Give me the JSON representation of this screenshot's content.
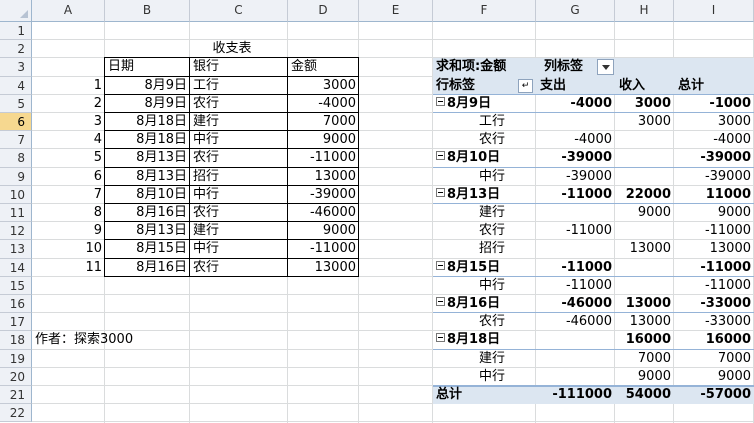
{
  "columns": [
    "A",
    "B",
    "C",
    "D",
    "E",
    "F",
    "G",
    "H",
    "I"
  ],
  "rows": [
    "1",
    "2",
    "3",
    "4",
    "5",
    "6",
    "7",
    "8",
    "9",
    "10",
    "11",
    "12",
    "13",
    "14",
    "15",
    "16",
    "17",
    "18",
    "19",
    "20",
    "21",
    "22"
  ],
  "selected_row": "6",
  "table": {
    "title": "收支表",
    "headers": [
      "日期",
      "银行",
      "金额"
    ],
    "rows": [
      {
        "idx": "1",
        "date": "8月9日",
        "bank": "工行",
        "amount": "3000"
      },
      {
        "idx": "2",
        "date": "8月9日",
        "bank": "农行",
        "amount": "-4000"
      },
      {
        "idx": "3",
        "date": "8月18日",
        "bank": "建行",
        "amount": "7000"
      },
      {
        "idx": "4",
        "date": "8月18日",
        "bank": "中行",
        "amount": "9000"
      },
      {
        "idx": "5",
        "date": "8月13日",
        "bank": "农行",
        "amount": "-11000"
      },
      {
        "idx": "6",
        "date": "8月13日",
        "bank": "招行",
        "amount": "13000"
      },
      {
        "idx": "7",
        "date": "8月10日",
        "bank": "中行",
        "amount": "-39000"
      },
      {
        "idx": "8",
        "date": "8月16日",
        "bank": "农行",
        "amount": "-46000"
      },
      {
        "idx": "9",
        "date": "8月13日",
        "bank": "建行",
        "amount": "9000"
      },
      {
        "idx": "10",
        "date": "8月15日",
        "bank": "中行",
        "amount": "-11000"
      },
      {
        "idx": "11",
        "date": "8月16日",
        "bank": "农行",
        "amount": "13000"
      }
    ]
  },
  "author": "作者：探索3000",
  "pivot": {
    "value_field": "求和项:金额",
    "col_label": "列标签",
    "row_label": "行标签",
    "col_headers": [
      "支出",
      "收入",
      "总计"
    ],
    "rows": [
      {
        "type": "group",
        "label": "8月9日",
        "v": [
          "-4000",
          "3000",
          "-1000"
        ]
      },
      {
        "type": "item",
        "label": "工行",
        "v": [
          "",
          "3000",
          "3000"
        ]
      },
      {
        "type": "item",
        "label": "农行",
        "v": [
          "-4000",
          "",
          "-4000"
        ]
      },
      {
        "type": "group",
        "label": "8月10日",
        "v": [
          "-39000",
          "",
          "-39000"
        ]
      },
      {
        "type": "item",
        "label": "中行",
        "v": [
          "-39000",
          "",
          "-39000"
        ]
      },
      {
        "type": "group",
        "label": "8月13日",
        "v": [
          "-11000",
          "22000",
          "11000"
        ]
      },
      {
        "type": "item",
        "label": "建行",
        "v": [
          "",
          "9000",
          "9000"
        ]
      },
      {
        "type": "item",
        "label": "农行",
        "v": [
          "-11000",
          "",
          "-11000"
        ]
      },
      {
        "type": "item",
        "label": "招行",
        "v": [
          "",
          "13000",
          "13000"
        ]
      },
      {
        "type": "group",
        "label": "8月15日",
        "v": [
          "-11000",
          "",
          "-11000"
        ]
      },
      {
        "type": "item",
        "label": "中行",
        "v": [
          "-11000",
          "",
          "-11000"
        ]
      },
      {
        "type": "group",
        "label": "8月16日",
        "v": [
          "-46000",
          "13000",
          "-33000"
        ]
      },
      {
        "type": "item",
        "label": "农行",
        "v": [
          "-46000",
          "13000",
          "-33000"
        ]
      },
      {
        "type": "group",
        "label": "8月18日",
        "v": [
          "",
          "16000",
          "16000"
        ]
      },
      {
        "type": "item",
        "label": "建行",
        "v": [
          "",
          "7000",
          "7000"
        ]
      },
      {
        "type": "item",
        "label": "中行",
        "v": [
          "",
          "9000",
          "9000"
        ]
      }
    ],
    "total": {
      "label": "总计",
      "v": [
        "-111000",
        "54000",
        "-57000"
      ]
    }
  }
}
